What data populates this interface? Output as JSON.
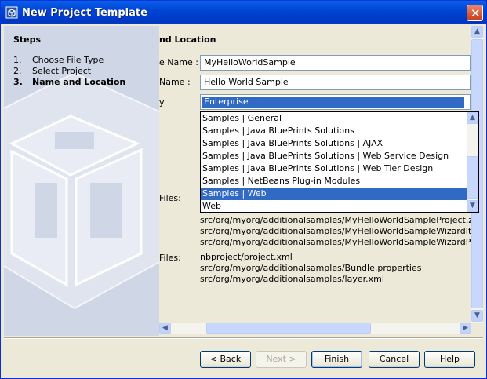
{
  "window": {
    "title": "New Project Template"
  },
  "steps": {
    "title": "Steps",
    "items": [
      {
        "num": "1.",
        "label": "Choose File Type",
        "current": false
      },
      {
        "num": "2.",
        "label": "Select Project",
        "current": false
      },
      {
        "num": "3.",
        "label": "Name and Location",
        "current": true
      }
    ]
  },
  "panel": {
    "section_title": "nd Location",
    "template_name": {
      "label": "e Name :",
      "value": "MyHelloWorldSample"
    },
    "display_name": {
      "label": "Name :",
      "value": "Hello World Sample"
    },
    "category": {
      "label": "y",
      "value": "Enterprise"
    },
    "created_files": {
      "label": "Files:",
      "items": [
        "src/org/myorg/additionalsamples/MyHelloWorldSampleProject.zip",
        "src/org/myorg/additionalsamples/MyHelloWorldSampleWizardIterator.java",
        "src/org/myorg/additionalsamples/MyHelloWorldSampleWizardPanel.java"
      ]
    },
    "modified_files": {
      "label": "Files:",
      "items": [
        "nbproject/project.xml",
        "src/org/myorg/additionalsamples/Bundle.properties",
        "src/org/myorg/additionalsamples/layer.xml"
      ]
    }
  },
  "category_dropdown": {
    "options": [
      "Samples | General",
      "Samples | Java BluePrints Solutions",
      "Samples | Java BluePrints Solutions | AJAX",
      "Samples | Java BluePrints Solutions | Web Service Design",
      "Samples | Java BluePrints Solutions | Web Tier Design",
      "Samples | NetBeans Plug-in Modules",
      "Samples | Web",
      "Web"
    ],
    "selected_index": 6
  },
  "buttons": {
    "back": "< Back",
    "next": "Next >",
    "finish": "Finish",
    "cancel": "Cancel",
    "help": "Help"
  },
  "icons": {
    "app": "netbeans-cube-icon",
    "close": "close-icon",
    "up": "arrow-up-icon",
    "down": "arrow-down-icon",
    "left": "arrow-left-icon",
    "right": "arrow-right-icon"
  },
  "colors": {
    "title_bar": "#0045d5",
    "selection": "#316ac5",
    "steps_bg": "#cfd6e6",
    "dialog_bg": "#ece9d8"
  }
}
